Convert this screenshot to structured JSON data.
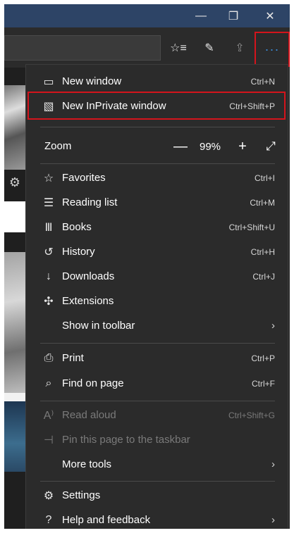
{
  "window": {
    "minimize_icon": "—",
    "maximize_icon": "❐",
    "close_icon": "✕"
  },
  "toolbar": {
    "favorites_icon": "☆≡",
    "notes_icon": "✎",
    "share_icon": "⇪",
    "more_icon": "···"
  },
  "menu": {
    "new_window": {
      "icon": "▭",
      "label": "New window",
      "shortcut": "Ctrl+N"
    },
    "new_inprivate": {
      "icon": "▧",
      "label": "New InPrivate window",
      "shortcut": "Ctrl+Shift+P"
    },
    "zoom": {
      "label": "Zoom",
      "minus": "—",
      "value": "99%",
      "plus": "+",
      "fullscreen": "⤢"
    },
    "items_a": [
      {
        "icon": "☆",
        "label": "Favorites",
        "shortcut": "Ctrl+I"
      },
      {
        "icon": "☰",
        "label": "Reading list",
        "shortcut": "Ctrl+M"
      },
      {
        "icon": "Ⅲ",
        "label": "Books",
        "shortcut": "Ctrl+Shift+U"
      },
      {
        "icon": "↺",
        "label": "History",
        "shortcut": "Ctrl+H"
      },
      {
        "icon": "↓",
        "label": "Downloads",
        "shortcut": "Ctrl+J"
      },
      {
        "icon": "✣",
        "label": "Extensions",
        "shortcut": ""
      },
      {
        "icon": "",
        "label": "Show in toolbar",
        "shortcut": ""
      }
    ],
    "items_b": [
      {
        "icon": "⎙",
        "label": "Print",
        "shortcut": "Ctrl+P"
      },
      {
        "icon": "⌕",
        "label": "Find on page",
        "shortcut": "Ctrl+F"
      }
    ],
    "items_c": [
      {
        "icon": "A⁾",
        "label": "Read aloud",
        "shortcut": "Ctrl+Shift+G"
      },
      {
        "icon": "⊣",
        "label": "Pin this page to the taskbar",
        "shortcut": ""
      },
      {
        "icon": "",
        "label": "More tools",
        "shortcut": ""
      }
    ],
    "items_d": [
      {
        "icon": "⚙",
        "label": "Settings",
        "shortcut": ""
      },
      {
        "icon": "?",
        "label": "Help and feedback",
        "shortcut": ""
      }
    ],
    "chevron": "›"
  },
  "page": {
    "gear_icon": "⚙"
  },
  "colors": {
    "titlebar": "#2d4466",
    "menu_bg": "#2b2b2b",
    "highlight_border": "#d4141c",
    "accent": "#3a8fde"
  }
}
